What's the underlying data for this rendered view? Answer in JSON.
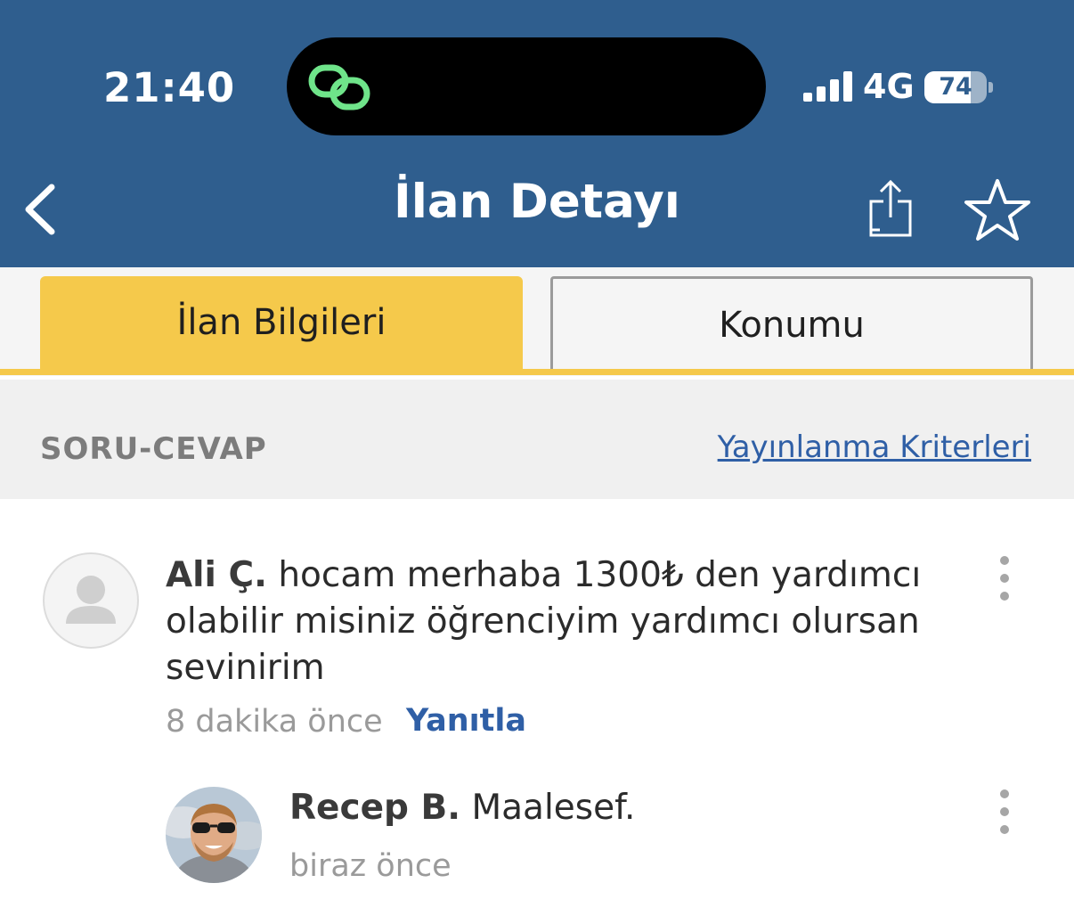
{
  "status_bar": {
    "time": "21:40",
    "network": "4G",
    "battery": "74",
    "battery_level": 0.74
  },
  "nav": {
    "title": "İlan Detayı"
  },
  "tabs": [
    {
      "label": "İlan Bilgileri",
      "active": true
    },
    {
      "label": "Konumu",
      "active": false
    }
  ],
  "section": {
    "title": "SORU-CEVAP",
    "link": "Yayınlanma Kriterleri"
  },
  "question": {
    "author": "Ali Ç.",
    "text": " hocam merhaba 1300₺ den yardımcı olabilir misiniz öğrenciyim yardımcı olursan sevinirim",
    "time": "8 dakika önce",
    "reply_label": "Yanıtla"
  },
  "answer": {
    "author": "Recep B.",
    "text": " Maalesef.",
    "time": "biraz önce"
  },
  "colors": {
    "header": "#2f5e8e",
    "accent": "#f5c94b",
    "link": "#2f5fa6"
  },
  "icons": [
    "back-chevron-icon",
    "share-icon",
    "star-icon",
    "more-vertical-icon",
    "user-placeholder-icon"
  ]
}
